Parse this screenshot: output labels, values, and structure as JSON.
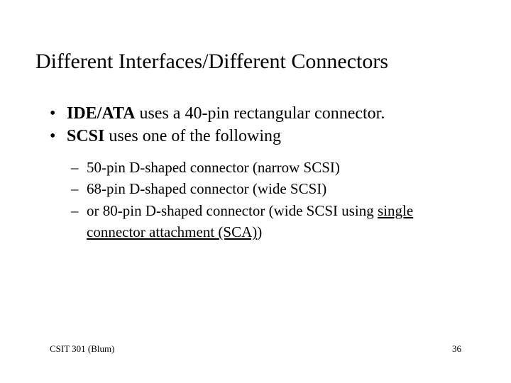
{
  "title": "Different Interfaces/Different Connectors",
  "b1": {
    "bold": "IDE/ATA",
    "rest": " uses a 40-pin rectangular connector."
  },
  "b2": {
    "bold": "SCSI",
    "rest": " uses one of the following"
  },
  "s1": "50-pin D-shaped connector (narrow SCSI)",
  "s2": "68-pin D-shaped connector (wide SCSI)",
  "s3_pre": "or 80-pin D-shaped connector (wide SCSI using ",
  "s3_link": "single connector attachment (SCA)",
  "s3_post": ")",
  "footer_left": "CSIT 301 (Blum)",
  "footer_right": "36"
}
